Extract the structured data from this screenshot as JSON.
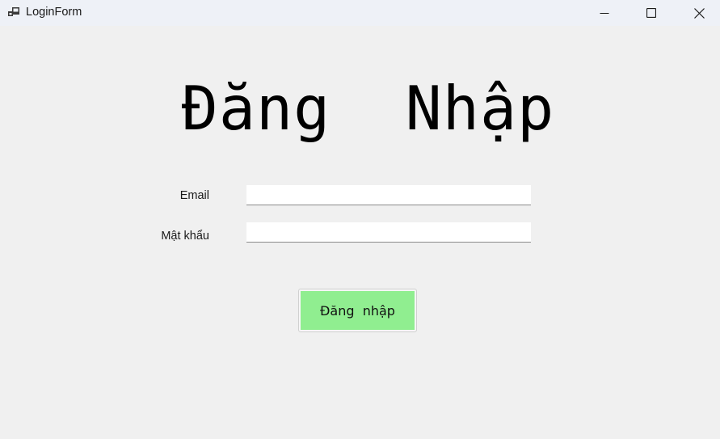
{
  "window": {
    "title": "LoginForm",
    "icon": "app-window-icon",
    "controls": [
      "minimize-icon",
      "maximize-icon",
      "close-icon"
    ]
  },
  "form": {
    "heading": "Đăng  Nhập",
    "email_label": "Email",
    "email_value": "",
    "password_label": "Mật khẩu",
    "password_value": "",
    "submit_label": "Đăng  nhập"
  },
  "colors": {
    "background": "#f0f0f0",
    "titlebar": "#eef1f7",
    "button_fill": "#90ee90",
    "heading_text": "#000000"
  }
}
